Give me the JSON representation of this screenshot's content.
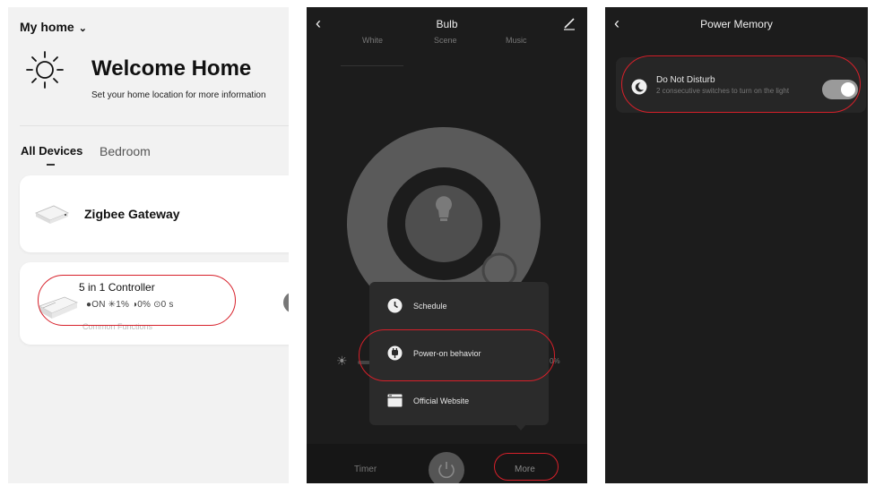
{
  "home": {
    "title": "My home",
    "welcome": "Welcome Home",
    "welcome_sub": "Set your home location for more information",
    "tabs": [
      {
        "label": "All Devices",
        "active": true
      },
      {
        "label": "Bedroom",
        "active": false
      }
    ],
    "devices": [
      {
        "name": "Zigbee Gateway"
      },
      {
        "name": "5 in 1 Controller",
        "status": "●ON  ✳1%  ◑0%  ⊙0 s",
        "subtext": "Common Functions"
      }
    ]
  },
  "bulb": {
    "title": "Bulb",
    "tabs": [
      "White",
      "Scene",
      "Music"
    ],
    "percent": "0%",
    "menu": [
      {
        "label": "Schedule",
        "icon": "clock-icon"
      },
      {
        "label": "Power-on behavior",
        "icon": "plug-icon"
      },
      {
        "label": "Official Website",
        "icon": "browser-icon"
      }
    ],
    "bottom": {
      "timer": "Timer",
      "more": "More"
    }
  },
  "power_memory": {
    "title": "Power Memory",
    "option": {
      "title": "Do Not Disturb",
      "subtitle": "2 consecutive switches to turn on the light",
      "enabled": true
    }
  },
  "colors": {
    "highlight": "#d7202a",
    "dark_bg": "#1c1c1c",
    "light_bg": "#f2f2f2"
  }
}
